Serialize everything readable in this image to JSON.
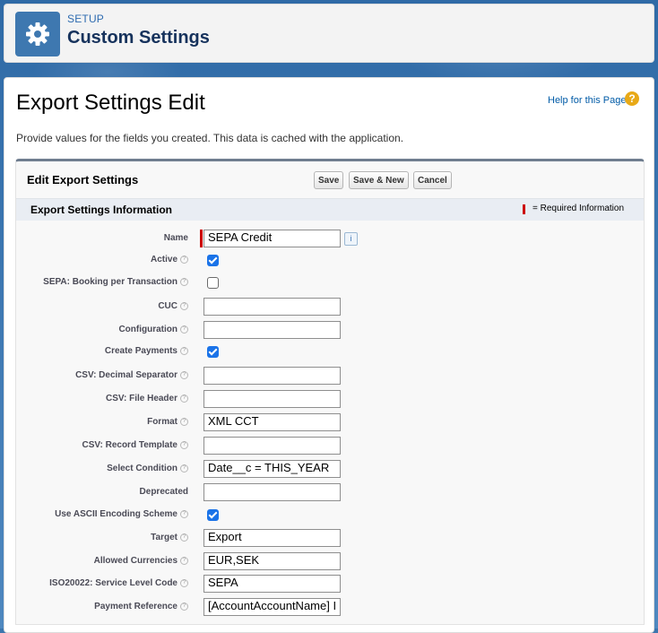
{
  "header": {
    "kicker": "SETUP",
    "title": "Custom Settings",
    "icon": "gear-icon"
  },
  "page": {
    "title": "Export Settings Edit",
    "help_link": "Help for this Page",
    "help_icon": "?",
    "description": "Provide values for the fields you created. This data is cached with the application."
  },
  "panel": {
    "title": "Edit Export Settings",
    "buttons": {
      "save": "Save",
      "save_new": "Save & New",
      "cancel": "Cancel"
    },
    "section_title": "Export Settings Information",
    "required_legend": "= Required Information"
  },
  "fields": {
    "name": {
      "label": "Name",
      "value": "SEPA Credit"
    },
    "active": {
      "label": "Active",
      "checked": true
    },
    "sepa_booking": {
      "label": "SEPA: Booking per Transaction",
      "checked": false
    },
    "cuc": {
      "label": "CUC",
      "value": ""
    },
    "configuration": {
      "label": "Configuration",
      "value": ""
    },
    "create_payments": {
      "label": "Create Payments",
      "checked": true
    },
    "csv_decimal": {
      "label": "CSV: Decimal Separator",
      "value": ""
    },
    "csv_header": {
      "label": "CSV: File Header",
      "value": ""
    },
    "format": {
      "label": "Format",
      "value": "XML CCT"
    },
    "csv_record": {
      "label": "CSV: Record Template",
      "value": ""
    },
    "select_condition": {
      "label": "Select Condition",
      "value": "Date__c = THIS_YEAR"
    },
    "deprecated": {
      "label": "Deprecated",
      "value": ""
    },
    "ascii": {
      "label": "Use ASCII Encoding Scheme",
      "checked": true
    },
    "target": {
      "label": "Target",
      "value": "Export"
    },
    "currencies": {
      "label": "Allowed Currencies",
      "value": "EUR,SEK"
    },
    "service_level": {
      "label": "ISO20022: Service Level Code",
      "value": "SEPA"
    },
    "payment_reference": {
      "label": "Payment Reference",
      "value": "[AccountAccountName] I"
    }
  },
  "colors": {
    "brand_blue": "#3e78b0",
    "required_red": "#cc0000",
    "checkbox_blue": "#1a73e8"
  }
}
